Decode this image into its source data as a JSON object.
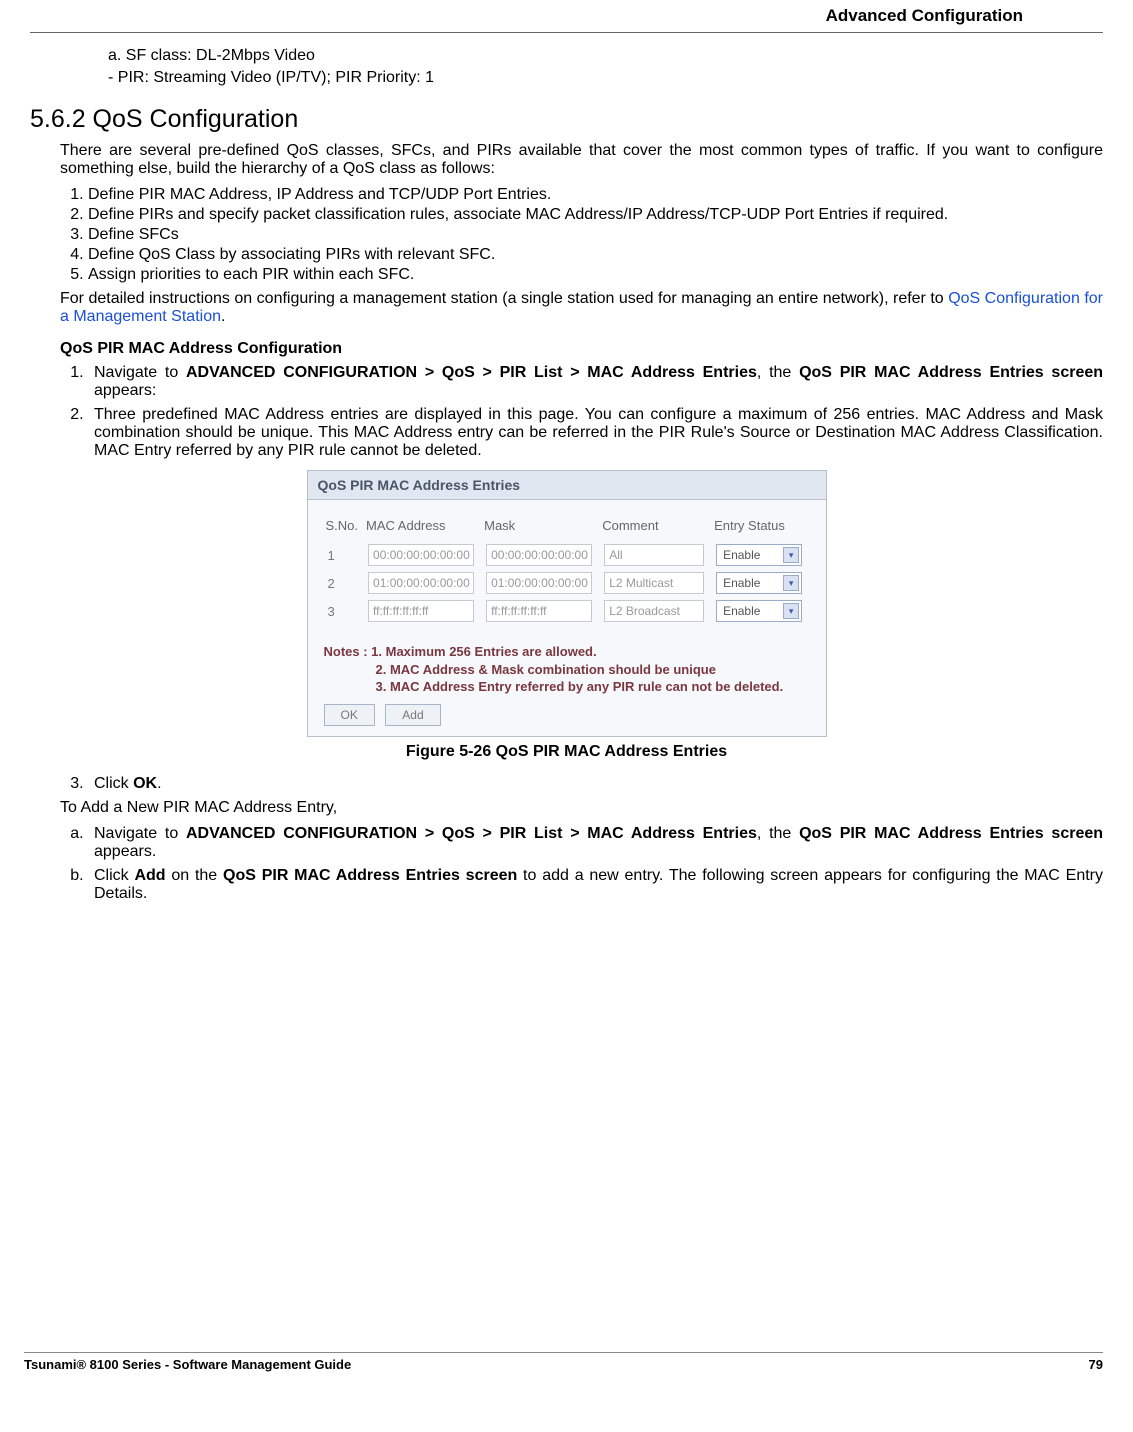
{
  "header": {
    "section_title": "Advanced Configuration"
  },
  "intro_items": {
    "a": "a.  SF class: DL-2Mbps Video",
    "b": "- PIR: Streaming Video (IP/TV); PIR Priority: 1"
  },
  "section": {
    "number_title": "5.6.2 QoS Configuration",
    "para1": "There are several pre-defined QoS classes, SFCs, and PIRs available that cover the most common types of traffic. If you want to configure something else, build the hierarchy of a QoS class as follows:",
    "steps": [
      "Define PIR MAC Address, IP Address and TCP/UDP Port Entries.",
      "Define PIRs and specify packet classification rules, associate MAC Address/IP Address/TCP-UDP Port Entries if required.",
      "Define SFCs",
      "Define QoS Class by associating PIRs with relevant SFC.",
      "Assign priorities to each PIR within each SFC."
    ],
    "para2_pre": "For detailed instructions on configuring a management station (a single station used for managing an entire network), refer to ",
    "para2_link": "QoS Configuration for a Management Station",
    "para2_post": "."
  },
  "subsection": {
    "title": "QoS PIR MAC Address Configuration",
    "step1_pre": "Navigate to ",
    "step1_bold1": "ADVANCED CONFIGURATION > QoS > PIR List > MAC Address Entries",
    "step1_mid": ", the ",
    "step1_bold2": "QoS PIR MAC Address Entries screen",
    "step1_post": " appears:",
    "step2": "Three predefined MAC Address entries are displayed in this page. You can configure a maximum of 256 entries. MAC Address and Mask combination should be unique. This MAC Address entry can be referred in the PIR Rule's Source or Destination MAC Address Classification. MAC Entry referred by any PIR rule cannot be deleted.",
    "step3_pre": "Click ",
    "step3_bold": "OK",
    "step3_post": "."
  },
  "screenshot": {
    "panel_title": "QoS PIR MAC Address Entries",
    "cols": {
      "sno": "S.No.",
      "mac": "MAC Address",
      "mask": "Mask",
      "comment": "Comment",
      "status": "Entry Status"
    },
    "rows": [
      {
        "sno": "1",
        "mac": "00:00:00:00:00:00",
        "mask": "00:00:00:00:00:00",
        "comment": "All",
        "status": "Enable"
      },
      {
        "sno": "2",
        "mac": "01:00:00:00:00:00",
        "mask": "01:00:00:00:00:00",
        "comment": "L2 Multicast",
        "status": "Enable"
      },
      {
        "sno": "3",
        "mac": "ff:ff:ff:ff:ff:ff",
        "mask": "ff:ff:ff:ff:ff:ff",
        "comment": "L2 Broadcast",
        "status": "Enable"
      }
    ],
    "notes_label": "Notes : 1. Maximum 256 Entries are allowed.",
    "note2": "2. MAC Address & Mask combination should be unique",
    "note3": "3. MAC Address Entry referred by any PIR rule can not be deleted.",
    "buttons": {
      "ok": "OK",
      "add": "Add"
    },
    "caption": "Figure 5-26 QoS PIR MAC Address Entries"
  },
  "add_flow": {
    "intro": "To Add a New PIR MAC Address Entry,",
    "a_pre": "Navigate to ",
    "a_bold1": "ADVANCED CONFIGURATION > QoS > PIR List > MAC Address Entries",
    "a_mid": ", the ",
    "a_bold2": "QoS PIR MAC Address Entries screen",
    "a_post": " appears.",
    "b_pre": "Click ",
    "b_bold1": "Add",
    "b_mid": " on the ",
    "b_bold2": "QoS PIR MAC Address Entries screen",
    "b_post": " to add a new entry. The following screen appears for configuring the MAC Entry Details."
  },
  "footer": {
    "left": "Tsunami® 8100 Series - Software Management Guide",
    "right": "79"
  }
}
